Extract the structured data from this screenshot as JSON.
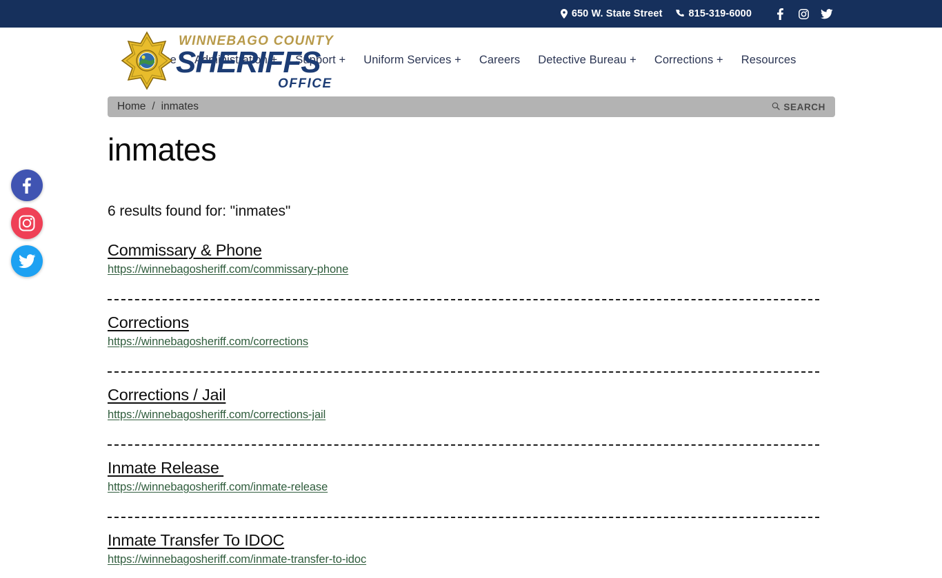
{
  "topbar": {
    "address": "650 W. State Street",
    "phone": "815-319-6000",
    "address_icon": "map-pin-icon",
    "phone_icon": "phone-icon",
    "social": [
      {
        "name": "facebook-icon",
        "label": "f"
      },
      {
        "name": "instagram-icon",
        "label": ""
      },
      {
        "name": "twitter-icon",
        "label": ""
      }
    ]
  },
  "logo": {
    "line1": "WINNEBAGO COUNTY",
    "line2": "SHERIFFS",
    "line3": "OFFICE",
    "badge_icon": "sheriff-star-badge-icon",
    "star_color": "#e0a81e",
    "text_color": "#1c3c74"
  },
  "nav": {
    "items": [
      {
        "label": "Home",
        "has_dropdown": false
      },
      {
        "label": "Administration +",
        "has_dropdown": true
      },
      {
        "label": "Support +",
        "has_dropdown": true
      },
      {
        "label": "Uniform Services +",
        "has_dropdown": true
      },
      {
        "label": "Careers",
        "has_dropdown": false
      },
      {
        "label": "Detective Bureau +",
        "has_dropdown": true
      },
      {
        "label": "Corrections +",
        "has_dropdown": true
      },
      {
        "label": "Resources",
        "has_dropdown": false
      }
    ]
  },
  "breadcrumb": {
    "home_label": "Home",
    "separator": "/",
    "current_label": "inmates",
    "search_label": "SEARCH",
    "search_icon": "search-icon"
  },
  "page": {
    "title": "inmates",
    "results_summary": "6 results found for: \"inmates\""
  },
  "results": [
    {
      "title": "Commissary & Phone",
      "url": "https://winnebagosheriff.com/commissary-phone"
    },
    {
      "title": "Corrections",
      "url": "https://winnebagosheriff.com/corrections"
    },
    {
      "title": "Corrections / Jail",
      "url": "https://winnebagosheriff.com/corrections-jail"
    },
    {
      "title": "Inmate Release ",
      "url": "https://winnebagosheriff.com/inmate-release"
    },
    {
      "title": "Inmate Transfer To IDOC",
      "url": "https://winnebagosheriff.com/inmate-transfer-to-idoc"
    }
  ],
  "social_rail": [
    {
      "name": "facebook-icon",
      "color": "#4054b2"
    },
    {
      "name": "instagram-icon",
      "color": "#ef4056"
    },
    {
      "name": "twitter-icon",
      "color": "#1da1f2"
    }
  ],
  "colors": {
    "topbar_bg": "#16305c",
    "nav_text": "#2b3553",
    "breadcrumb_bg": "#b3b3b3",
    "url_green": "#2f5c3c"
  }
}
